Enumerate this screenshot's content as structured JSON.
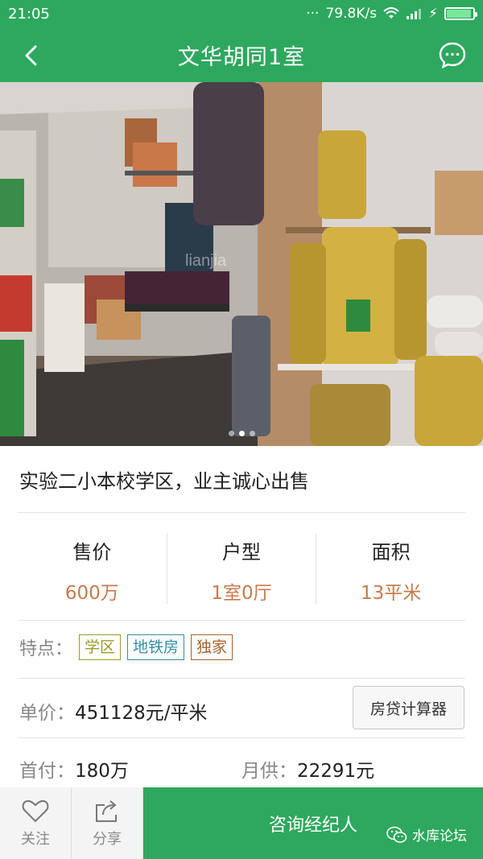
{
  "status_bar": {
    "time": "21:05",
    "network_speed": "79.8K/s",
    "battery_level": 0.95
  },
  "header": {
    "title": "文华胡同1室",
    "back_icon": "chevron-left-icon",
    "chat_icon": "chat-bubble-icon"
  },
  "gallery": {
    "total_images": 3,
    "active_index": 1,
    "watermark": "lianjia"
  },
  "listing": {
    "headline": "实验二小本校学区，业主诚心出售",
    "stats": [
      {
        "label": "售价",
        "value": "600万"
      },
      {
        "label": "户型",
        "value": "1室0厅"
      },
      {
        "label": "面积",
        "value": "13平米"
      }
    ],
    "features": {
      "label": "特点：",
      "tags": [
        {
          "text": "学区",
          "color": "#9a9a2c"
        },
        {
          "text": "地铁房",
          "color": "#2f8fa8"
        },
        {
          "text": "独家",
          "color": "#a8642f"
        }
      ]
    },
    "unit_price": {
      "label": "单价：",
      "value": "451128元/平米"
    },
    "calculator_button": "房贷计算器",
    "down_payment": {
      "label": "首付：",
      "value": "180万"
    },
    "monthly_payment": {
      "label": "月供：",
      "value": "22291元"
    }
  },
  "bottom_bar": {
    "follow": {
      "label": "关注",
      "icon": "heart-outline-icon"
    },
    "share": {
      "label": "分享",
      "icon": "share-icon"
    },
    "consult": {
      "label": "咨询经纪人"
    },
    "watermark": "水库论坛"
  },
  "colors": {
    "brand_green": "#2ea85e",
    "price_accent": "#c87a4b"
  }
}
